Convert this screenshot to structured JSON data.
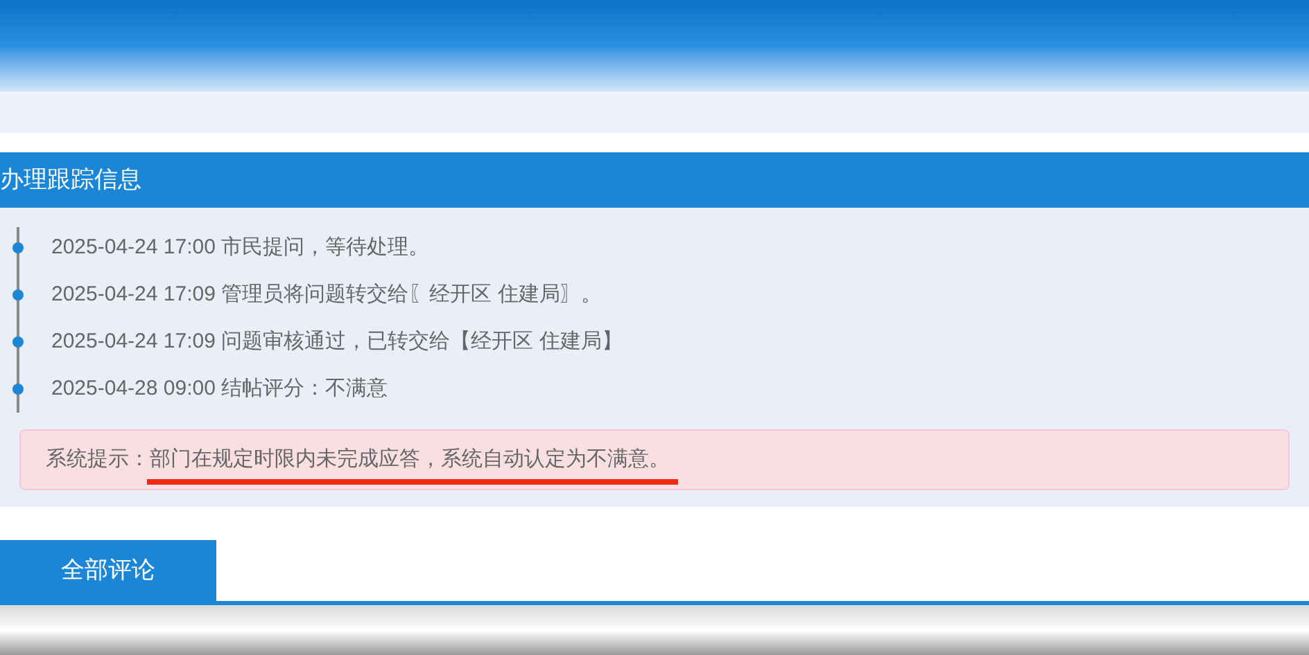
{
  "section": {
    "title": "办理跟踪信息"
  },
  "timeline": [
    {
      "text": "2025-04-24 17:00 市民提问，等待处理。"
    },
    {
      "text": "2025-04-24 17:09 管理员将问题转交给〖经开区 住建局〗。"
    },
    {
      "text": "2025-04-24 17:09 问题审核通过，已转交给【经开区 住建局】"
    },
    {
      "text": "2025-04-28 09:00 结帖评分：不满意"
    }
  ],
  "notice": {
    "label": "系统提示：",
    "message": "部门在规定时限内未完成应答，系统自动认定为不满意。",
    "underlined": true
  },
  "tabs": [
    {
      "label": "全部评论",
      "selected": true
    }
  ]
}
